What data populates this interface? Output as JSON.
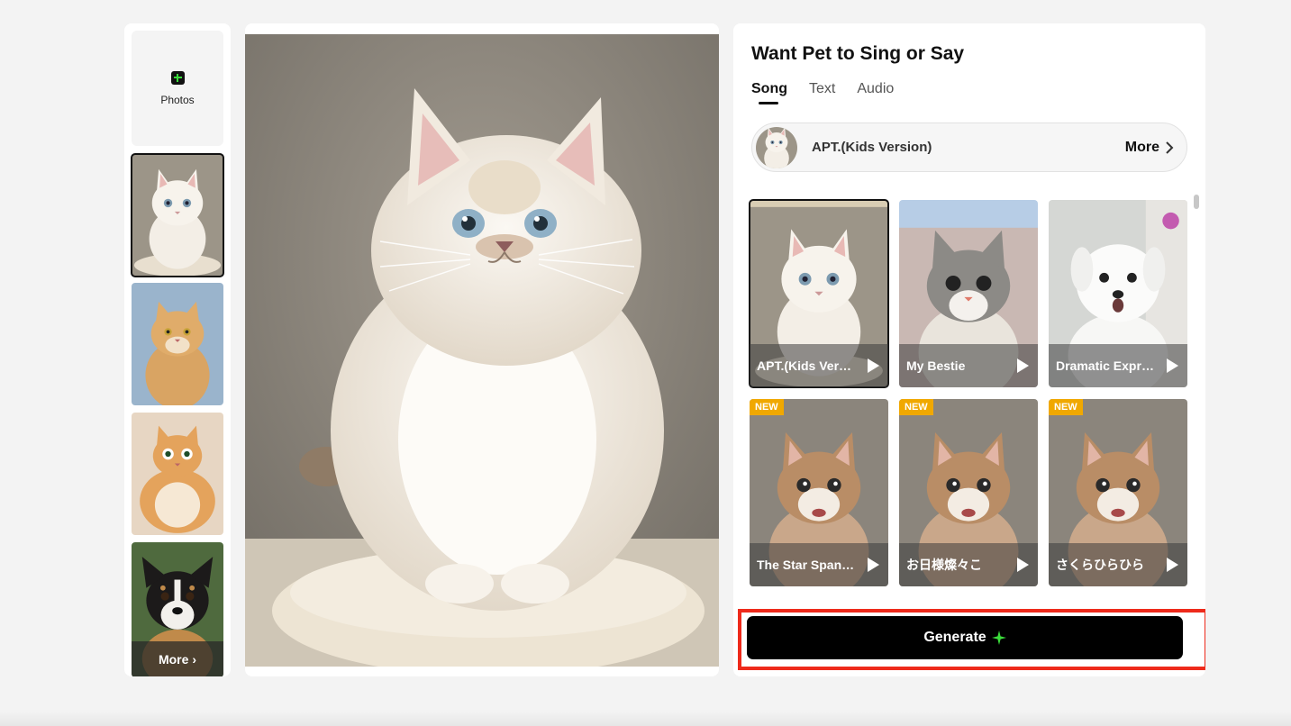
{
  "sidebar": {
    "add_label": "Photos",
    "more_label": "More",
    "thumbs": [
      {
        "name": "white-persian-cat",
        "selected": true
      },
      {
        "name": "ginger-cat-blue-bg",
        "selected": false
      },
      {
        "name": "chubby-orange-cat",
        "selected": false
      },
      {
        "name": "tricolor-puppy",
        "selected": false
      }
    ]
  },
  "panel": {
    "title": "Want Pet to Sing or Say",
    "tabs": [
      {
        "label": "Song",
        "active": true
      },
      {
        "label": "Text",
        "active": false
      },
      {
        "label": "Audio",
        "active": false
      }
    ],
    "selected_song": {
      "name": "APT.(Kids Version)",
      "more_label": "More"
    },
    "songs": [
      {
        "title": "APT.(Kids Version)",
        "badge": "",
        "selected": true
      },
      {
        "title": "My Bestie",
        "badge": "",
        "selected": false
      },
      {
        "title": "Dramatic Expression",
        "badge": "",
        "selected": false
      },
      {
        "title": "The Star Spangled Banner",
        "badge": "NEW",
        "selected": false
      },
      {
        "title": "お日様燦々こ",
        "badge": "NEW",
        "selected": false
      },
      {
        "title": "さくらひらひら",
        "badge": "NEW",
        "selected": false
      }
    ],
    "generate_label": "Generate"
  },
  "colors": {
    "accent_green": "#3bdc3b",
    "highlight_red": "#ee2a1b",
    "badge_orange": "#f0a800",
    "button_black": "#000000"
  }
}
